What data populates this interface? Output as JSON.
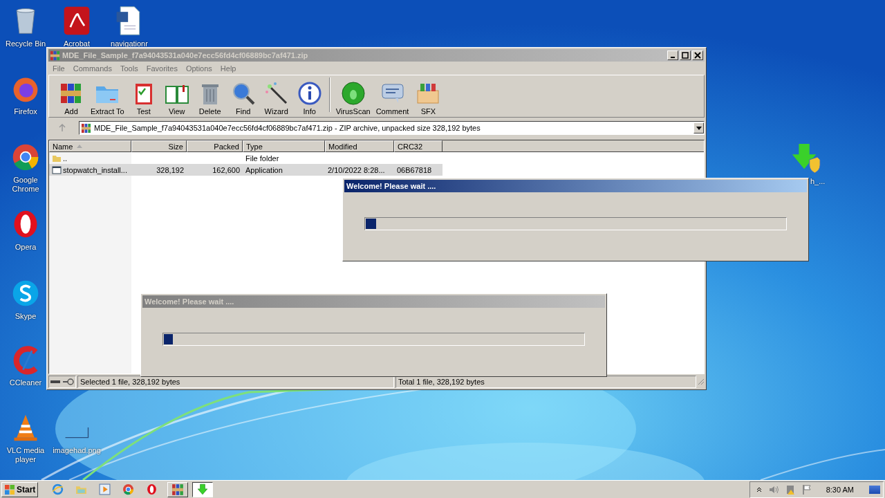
{
  "desktop_icons": [
    {
      "label": "Recycle Bin"
    },
    {
      "label": "Acrobat"
    },
    {
      "label": "navigationr"
    },
    {
      "label": "Firefox"
    },
    {
      "label": "Google Chrome"
    },
    {
      "label": "Opera"
    },
    {
      "label": "Skype"
    },
    {
      "label": "CCleaner"
    },
    {
      "label": "VLC media player"
    },
    {
      "label": "imagehad.png"
    },
    {
      "label": "h_..."
    }
  ],
  "archive_window": {
    "title": "MDE_File_Sample_f7a94043531a040e7ecc56fd4cf06889bc7af471.zip",
    "menu": [
      "File",
      "Commands",
      "Tools",
      "Favorites",
      "Options",
      "Help"
    ],
    "toolbar": [
      {
        "label": "Add"
      },
      {
        "label": "Extract To"
      },
      {
        "label": "Test"
      },
      {
        "label": "View"
      },
      {
        "label": "Delete"
      },
      {
        "label": "Find"
      },
      {
        "label": "Wizard"
      },
      {
        "label": "Info"
      },
      {
        "label": "VirusScan"
      },
      {
        "label": "Comment"
      },
      {
        "label": "SFX"
      }
    ],
    "path": "MDE_File_Sample_f7a94043531a040e7ecc56fd4cf06889bc7af471.zip - ZIP archive, unpacked size 328,192 bytes",
    "columns": [
      "Name",
      "Size",
      "Packed",
      "Type",
      "Modified",
      "CRC32"
    ],
    "rows": [
      {
        "name": "..",
        "type": "File folder",
        "selected": false
      },
      {
        "name": "stopwatch_install...",
        "size": "328,192",
        "packed": "162,600",
        "type": "Application",
        "modified": "2/10/2022 8:28...",
        "crc32": "06B67818",
        "selected": true
      }
    ],
    "status_left": "Selected 1 file, 328,192 bytes",
    "status_right": "Total 1 file, 328,192 bytes"
  },
  "dialogs": [
    {
      "title": "Welcome! Please wait ....",
      "active": true,
      "level": 0.025
    },
    {
      "title": "Welcome! Please wait ....",
      "active": false,
      "level": 0.022
    }
  ],
  "taskbar": {
    "start": "Start",
    "tasks": [
      {
        "selected": false
      },
      {
        "selected": true
      }
    ],
    "clock": "8:30 AM"
  }
}
